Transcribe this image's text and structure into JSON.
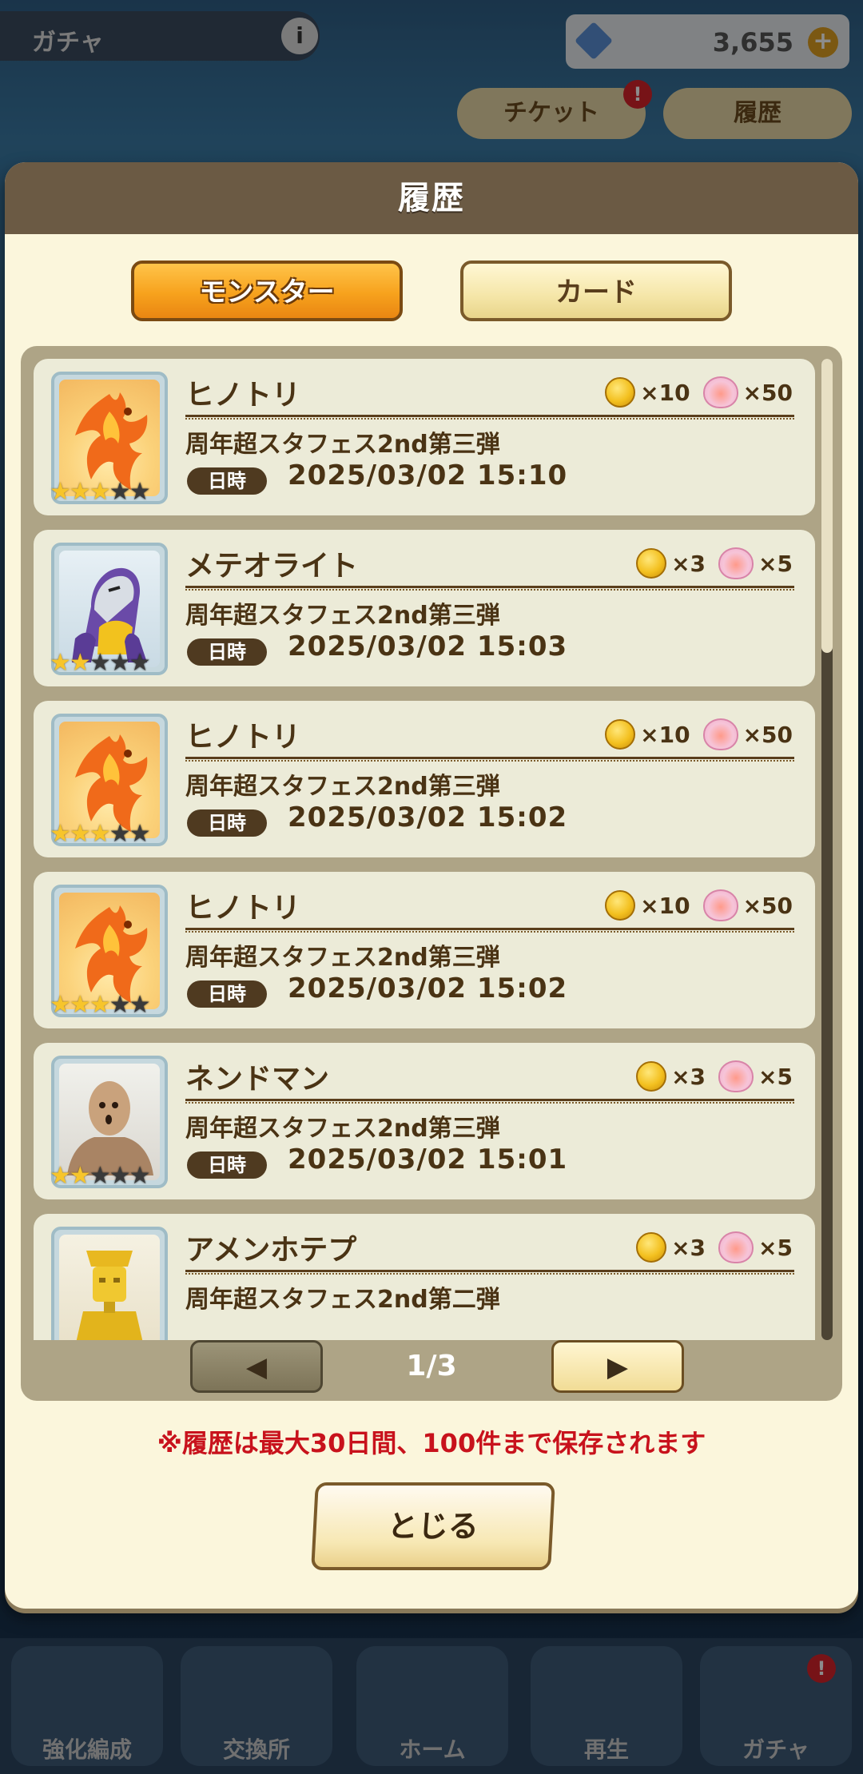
{
  "background": {
    "title": "ガチャ",
    "info_label": "i",
    "currency_value": "3,655",
    "currency_plus": "+",
    "ticket_label": "チケット",
    "ticket_badge": "!",
    "history_label": "履歴",
    "nav": [
      "強化編成",
      "交換所",
      "ホーム",
      "再生",
      "ガチャ"
    ],
    "nav_badge": "!"
  },
  "modal": {
    "title": "履歴",
    "tabs": {
      "monster": "モンスター",
      "card": "カード"
    },
    "colors": {
      "header": "#6b5a44",
      "active_tab": "#f7a21d",
      "note": "#c8121c"
    },
    "date_label": "日時",
    "entries": [
      {
        "name": "ヒノトリ",
        "event": "周年超スタフェス2nd第三弾",
        "date": "2025/03/02 15:10",
        "stars": 3,
        "stars_max": 5,
        "coin": "×10",
        "heart": "×50",
        "image": "fire-bird"
      },
      {
        "name": "メテオライト",
        "event": "周年超スタフェス2nd第三弾",
        "date": "2025/03/02 15:03",
        "stars": 2,
        "stars_max": 5,
        "coin": "×3",
        "heart": "×5",
        "image": "silver-warrior"
      },
      {
        "name": "ヒノトリ",
        "event": "周年超スタフェス2nd第三弾",
        "date": "2025/03/02 15:02",
        "stars": 3,
        "stars_max": 5,
        "coin": "×10",
        "heart": "×50",
        "image": "fire-bird"
      },
      {
        "name": "ヒノトリ",
        "event": "周年超スタフェス2nd第三弾",
        "date": "2025/03/02 15:02",
        "stars": 3,
        "stars_max": 5,
        "coin": "×10",
        "heart": "×50",
        "image": "fire-bird"
      },
      {
        "name": "ネンドマン",
        "event": "周年超スタフェス2nd第三弾",
        "date": "2025/03/02 15:01",
        "stars": 2,
        "stars_max": 5,
        "coin": "×3",
        "heart": "×5",
        "image": "clay-man"
      },
      {
        "name": "アメンホテプ",
        "event": "周年超スタフェス2nd第二弾",
        "date": "",
        "stars": 0,
        "stars_max": 5,
        "coin": "×3",
        "heart": "×5",
        "image": "gold-pharaoh"
      }
    ],
    "pager": {
      "prev_icon": "◀",
      "next_icon": "▶",
      "page": "1/3"
    },
    "note": "※履歴は最大30日間、100件まで保存されます",
    "close_label": "とじる"
  }
}
